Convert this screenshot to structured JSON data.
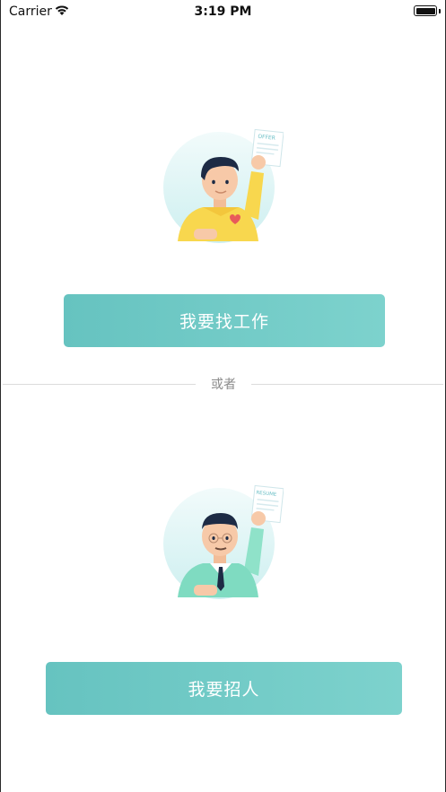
{
  "status_bar": {
    "carrier": "Carrier",
    "time": "3:19 PM",
    "wifi_icon": "wifi-icon",
    "battery_icon": "battery-icon"
  },
  "illustrations": {
    "job_seeker": {
      "icon": "job-seeker-illustration",
      "paper_text": "OFFER"
    },
    "recruiter": {
      "icon": "recruiter-illustration",
      "paper_text": "RESUME"
    }
  },
  "buttons": {
    "find_job": "我要找工作",
    "recruit": "我要招人"
  },
  "divider": {
    "text": "或者"
  },
  "colors": {
    "button_start": "#66c3c0",
    "button_end": "#7dd2cd",
    "circle_bg": "#e6f6f6",
    "yellow_shirt": "#f8d74e",
    "green_shirt": "#7fdbc1"
  }
}
